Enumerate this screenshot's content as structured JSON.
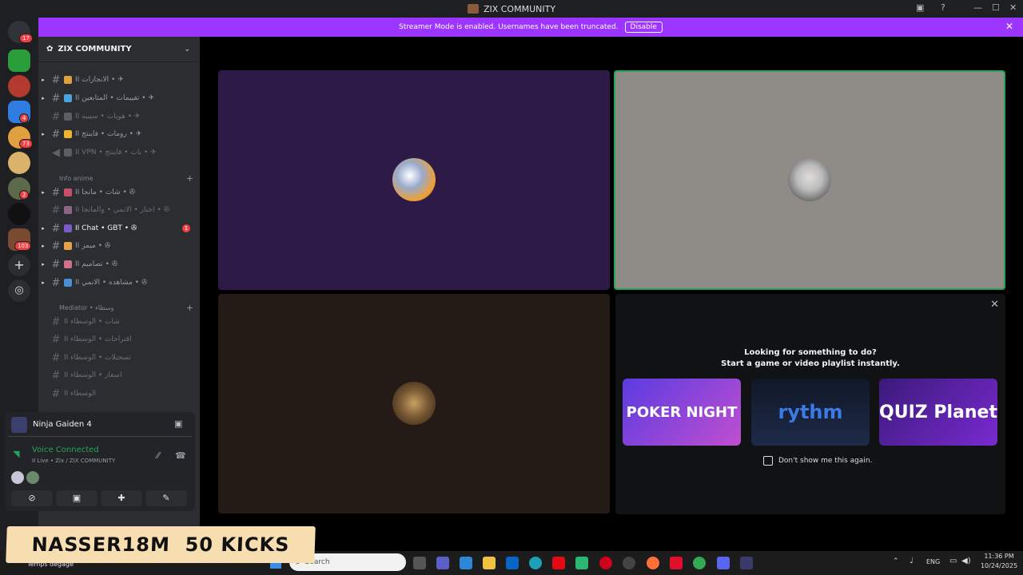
{
  "window": {
    "title": "ZIX COMMUNITY"
  },
  "banner": {
    "text": "Streamer Mode is enabled. Usernames have been truncated.",
    "disable_label": "Disable"
  },
  "server_badges": [
    "17",
    "4",
    "73",
    "2",
    "103"
  ],
  "server": {
    "name": "ZIX COMMUNITY"
  },
  "channels_top": [
    {
      "label": "II الانجازات • ✈",
      "emoji_color": "#e0a040"
    },
    {
      "label": "II تقييمات • المتابعين • ✈",
      "emoji_color": "#4aa3df"
    },
    {
      "label": "II هويات • سيبيه • ✈",
      "emoji_color": "#7a7f88",
      "muted": true
    },
    {
      "label": "II رومات • فاينتج • ✈",
      "emoji_color": "#f0b232"
    },
    {
      "label": "II VPN • بات • فاينتج • ✈",
      "emoji_color": "#7a7f88",
      "muted": true
    }
  ],
  "category_anime": {
    "label": "Info anime"
  },
  "channels_anime": [
    {
      "label": "II شات • مانجا • ✇",
      "emoji_color": "#c9506a"
    },
    {
      "label": "II اخبار • الانمي • والمانجا • ✇",
      "emoji_color": "#d08bb8",
      "muted": true
    },
    {
      "label": "II Chat • GBT • ✇",
      "emoji_color": "#7a5cc7",
      "unread": "1"
    },
    {
      "label": "II ميمز • ✇",
      "emoji_color": "#e8a04a"
    },
    {
      "label": "II تصاميم • ✇",
      "emoji_color": "#d0708a"
    },
    {
      "label": "II مشاهده • الانمي • ✇",
      "emoji_color": "#4a8fd6"
    }
  ],
  "category_mediator": {
    "label": "Mediator • وسطاء"
  },
  "channels_mediator": [
    {
      "label": "II شات • الوسطاء"
    },
    {
      "label": "II اقتراحات • الوسطاء"
    },
    {
      "label": "II تسجيلات • الوسطاء"
    },
    {
      "label": "II اسعار • الوسطاء"
    },
    {
      "label": "II الوسطاء"
    }
  ],
  "activity": {
    "game": "Ninja Gaiden 4"
  },
  "voice": {
    "status": "Voice Connected",
    "channel": "II Live • Zix / ZIX COMMUNITY"
  },
  "promo": {
    "line1": "Looking for something to do?",
    "line2": "Start a game or video playlist instantly.",
    "cards": [
      "POKER NIGHT",
      "rythm",
      "QUIZ Planet"
    ],
    "checkbox_label": "Don't show me this again."
  },
  "overlay": {
    "text": "NASSER18M  50 KICKS"
  },
  "taskbar": {
    "search_placeholder": "Search",
    "weather_text": "Temps dégagé",
    "lang": "ENG",
    "time": "11:36 PM",
    "date": "10/24/2025"
  },
  "colors": {
    "accent": "#9b35ff",
    "tile1": "#2e1a47",
    "tile2": "#8f8b87",
    "tile3": "#241b16",
    "voice_green": "#23a55a"
  }
}
